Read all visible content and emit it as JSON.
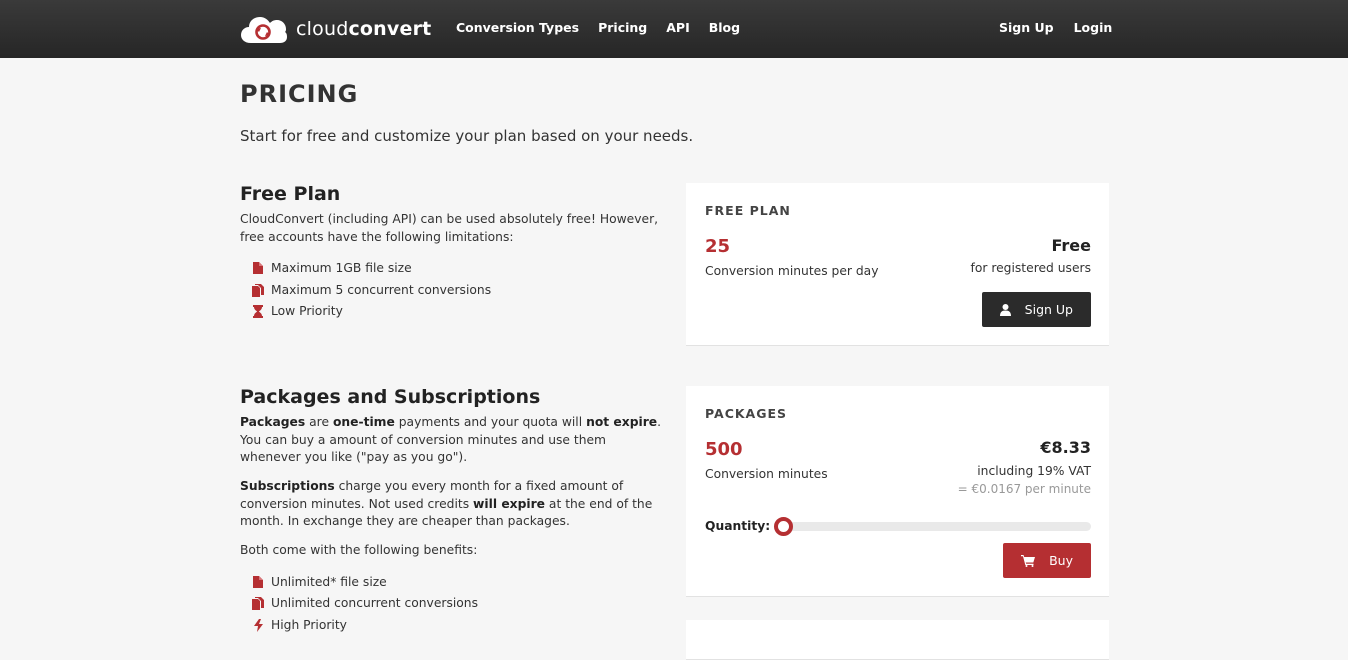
{
  "brand": {
    "name_light": "cloud",
    "name_bold": "convert",
    "accent": "#b52f32"
  },
  "nav": {
    "items": [
      "Conversion Types",
      "Pricing",
      "API",
      "Blog"
    ]
  },
  "auth": {
    "signup": "Sign Up",
    "login": "Login"
  },
  "page": {
    "title": "PRICING",
    "subtitle": "Start for free and customize your plan based on your needs."
  },
  "free_section": {
    "heading": "Free Plan",
    "intro": "CloudConvert (including API) can be used absolutely free! However, free accounts have the following limitations:",
    "features": [
      {
        "icon": "file-icon",
        "text": "Maximum 1GB file size"
      },
      {
        "icon": "files-icon",
        "text": "Maximum 5 concurrent conversions"
      },
      {
        "icon": "hourglass-icon",
        "text": "Low Priority"
      }
    ]
  },
  "packages_section": {
    "heading": "Packages and Subscriptions",
    "p1": {
      "t1": "Packages",
      "t2": " are ",
      "t3": "one-time",
      "t4": " payments and your quota will ",
      "t5": "not expire",
      "t6": ". You can buy a amount of conversion minutes and use them whenever you like (\"pay as you go\")."
    },
    "p2": {
      "t1": "Subscriptions",
      "t2": " charge you every month for a fixed amount of conversion minutes. Not used credits ",
      "t3": "will expire",
      "t4": " at the end of the month. In exchange they are cheaper than packages."
    },
    "p3": "Both come with the following benefits:",
    "features": [
      {
        "icon": "file-icon",
        "text": "Unlimited* file size"
      },
      {
        "icon": "files-icon",
        "text": "Unlimited concurrent conversions"
      },
      {
        "icon": "bolt-icon",
        "text": "High Priority"
      }
    ]
  },
  "free_card": {
    "heading": "FREE PLAN",
    "amount": "25",
    "amount_label": "Conversion minutes per day",
    "price": "Free",
    "price_note": "for registered users",
    "button": "Sign Up"
  },
  "packages_card": {
    "heading": "PACKAGES",
    "amount": "500",
    "amount_label": "Conversion minutes",
    "price": "€8.33",
    "price_note": "including 19% VAT",
    "per_minute": "= €0.0167 per minute",
    "quantity_label": "Quantity:",
    "quantity_level": 0,
    "button": "Buy"
  }
}
